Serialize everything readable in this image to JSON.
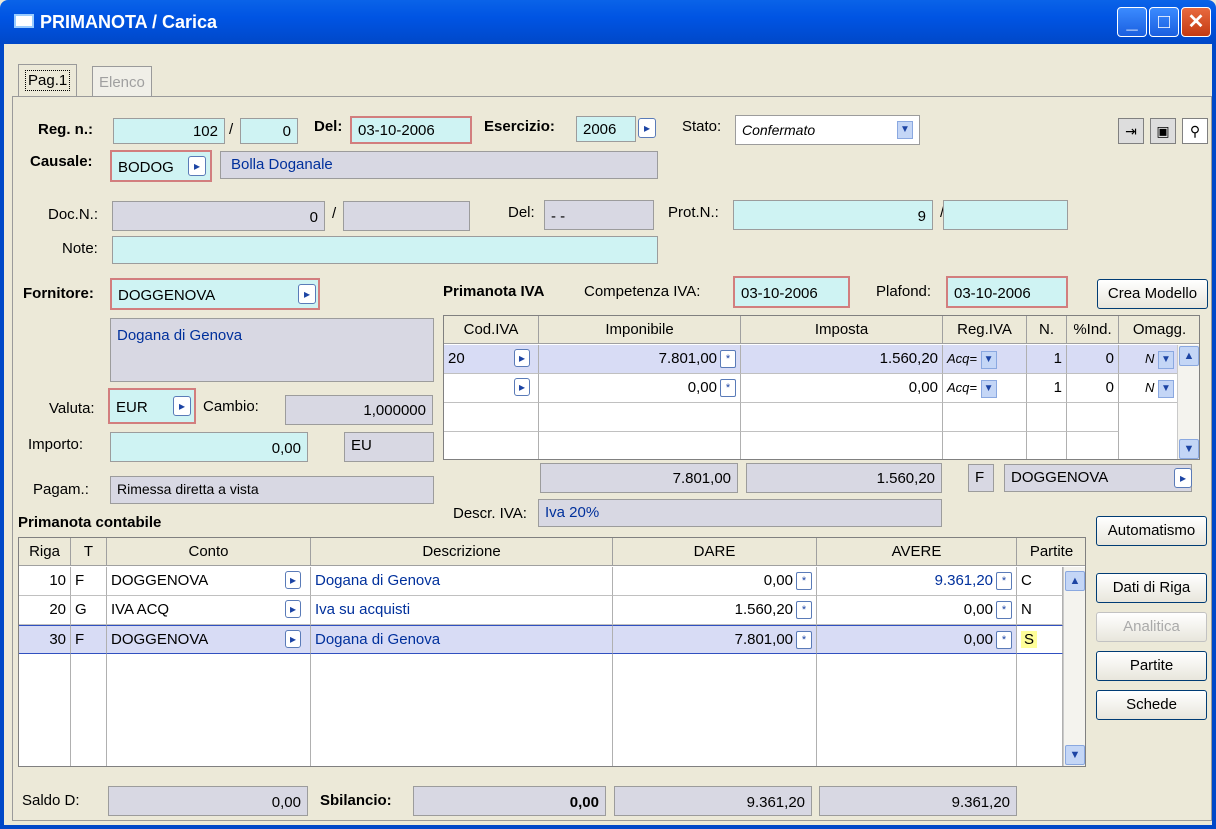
{
  "window": {
    "title": "PRIMANOTA / Carica"
  },
  "tabs": [
    {
      "label": "Pag.1"
    },
    {
      "label": "Elenco"
    }
  ],
  "header": {
    "reg_label": "Reg. n.:",
    "reg_num": "102",
    "reg_sep": "/",
    "reg_sub": "0",
    "del_label": "Del:",
    "del_value": "03-10-2006",
    "esercizio_label": "Esercizio:",
    "esercizio_value": "2006",
    "stato_label": "Stato:",
    "stato_value": "Confermato",
    "causale_label": "Causale:",
    "causale_code": "BODOG",
    "causale_desc": "Bolla Doganale",
    "docn_label": "Doc.N.:",
    "docn_value": "0",
    "docn_sep": "/",
    "docn_sub": "",
    "docdel_label": "Del:",
    "docdel_value": "- -",
    "prot_label": "Prot.N.:",
    "prot_value": "9",
    "prot_sep": "/",
    "prot_sub": "",
    "note_label": "Note:",
    "note_value": ""
  },
  "fornitore": {
    "label": "Fornitore:",
    "code": "DOGGENOVA",
    "desc": "Dogana di Genova",
    "valuta_label": "Valuta:",
    "valuta_value": "EUR",
    "cambio_label": "Cambio:",
    "cambio_value": "1,000000",
    "importo_label": "Importo:",
    "importo_value": "0,00",
    "importo_area": "EU",
    "pagam_label": "Pagam.:",
    "pagam_value": "Rimessa diretta a vista"
  },
  "iva": {
    "title": "Primanota IVA",
    "competenza_label": "Competenza IVA:",
    "competenza_value": "03-10-2006",
    "plafond_label": "Plafond:",
    "plafond_value": "03-10-2006",
    "crea_modello": "Crea Modello",
    "columns": [
      "Cod.IVA",
      "Imponibile",
      "Imposta",
      "Reg.IVA",
      "N.",
      "%Ind.",
      "Omagg."
    ],
    "rows": [
      {
        "cod": "20",
        "imponibile": "7.801,00",
        "imposta": "1.560,20",
        "reg": "Acq=",
        "n": "1",
        "ind": "0",
        "omagg": "N"
      },
      {
        "cod": "",
        "imponibile": "0,00",
        "imposta": "0,00",
        "reg": "Acq=",
        "n": "1",
        "ind": "0",
        "omagg": "N"
      }
    ],
    "total_imponibile": "7.801,00",
    "total_imposta": "1.560,20",
    "tipo": "F",
    "tipo_code": "DOGGENOVA",
    "descr_label": "Descr. IVA:",
    "descr_value": "Iva 20%"
  },
  "contabile": {
    "title": "Primanota contabile",
    "columns": [
      "Riga",
      "T",
      "Conto",
      "Descrizione",
      "DARE",
      "AVERE",
      "Partite"
    ],
    "rows": [
      {
        "riga": "10",
        "t": "F",
        "conto": "DOGGENOVA",
        "descr": "Dogana di Genova",
        "dare": "0,00",
        "avere": "9.361,20",
        "partite": "C"
      },
      {
        "riga": "20",
        "t": "G",
        "conto": "IVA ACQ",
        "descr": "Iva su acquisti",
        "dare": "1.560,20",
        "avere": "0,00",
        "partite": "N"
      },
      {
        "riga": "30",
        "t": "F",
        "conto": "DOGGENOVA",
        "descr": "Dogana di Genova",
        "dare": "7.801,00",
        "avere": "0,00",
        "partite": "S"
      }
    ],
    "saldo_label": "Saldo D:",
    "saldo_value": "0,00",
    "sbilancio_label": "Sbilancio:",
    "sbilancio_value": "0,00",
    "total_dare": "9.361,20",
    "total_avere": "9.361,20"
  },
  "buttons": {
    "automatismo": "Automatismo",
    "dati_riga": "Dati di Riga",
    "analitica": "Analitica",
    "partite": "Partite",
    "schede": "Schede"
  }
}
